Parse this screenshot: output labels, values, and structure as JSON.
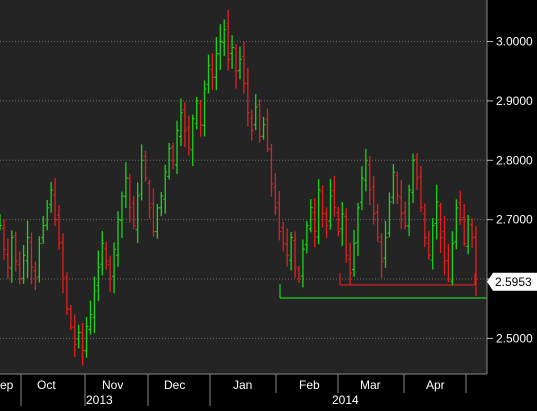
{
  "chart_data": {
    "type": "ohlc",
    "colors": {
      "up": "#1ed21e",
      "down": "#e02020",
      "support": "#22cc22",
      "resistance": "#e02020",
      "grid": "#6a6a6a",
      "text": "#ffffff",
      "price_tag_bg": "#ffffff",
      "price_tag_text": "#000000"
    },
    "y_axis": {
      "range": [
        2.44,
        3.07
      ],
      "ticks": [
        "3.0000",
        "2.9000",
        "2.8000",
        "2.7000",
        "2.6000",
        "2.5000"
      ],
      "tick_values": [
        3.0,
        2.9,
        2.8,
        2.7,
        2.6,
        2.5
      ]
    },
    "x_axis": {
      "months": [
        "Sep",
        "Oct",
        "Nov",
        "Dec",
        "Jan",
        "Feb",
        "Mar",
        "Apr"
      ],
      "years": [
        "2013",
        "2014"
      ]
    },
    "last_price": "2.5953",
    "last_price_value": 2.5953,
    "levels": [
      {
        "name": "support",
        "value": 2.568,
        "color": "#22cc22"
      },
      {
        "name": "resistance",
        "value": 2.59,
        "color": "#e02020"
      }
    ],
    "closes": [
      2.69,
      2.65,
      2.62,
      2.67,
      2.63,
      2.6,
      2.64,
      2.67,
      2.62,
      2.6,
      2.66,
      2.69,
      2.72,
      2.75,
      2.7,
      2.66,
      2.6,
      2.55,
      2.52,
      2.49,
      2.51,
      2.48,
      2.52,
      2.54,
      2.58,
      2.62,
      2.66,
      2.63,
      2.6,
      2.65,
      2.7,
      2.74,
      2.77,
      2.72,
      2.69,
      2.74,
      2.8,
      2.77,
      2.72,
      2.68,
      2.72,
      2.74,
      2.78,
      2.82,
      2.8,
      2.85,
      2.88,
      2.85,
      2.82,
      2.87,
      2.9,
      2.86,
      2.92,
      2.96,
      2.94,
      2.98,
      3.0,
      3.02,
      2.97,
      2.99,
      2.95,
      2.97,
      2.93,
      2.88,
      2.85,
      2.89,
      2.84,
      2.86,
      2.82,
      2.76,
      2.72,
      2.68,
      2.66,
      2.64,
      2.67,
      2.62,
      2.6,
      2.65,
      2.69,
      2.72,
      2.68,
      2.75,
      2.71,
      2.69,
      2.74,
      2.72,
      2.68,
      2.71,
      2.64,
      2.61,
      2.66,
      2.72,
      2.77,
      2.8,
      2.75,
      2.71,
      2.67,
      2.63,
      2.67,
      2.73,
      2.78,
      2.74,
      2.71,
      2.69,
      2.75,
      2.8,
      2.77,
      2.72,
      2.67,
      2.64,
      2.69,
      2.73,
      2.67,
      2.63,
      2.6,
      2.66,
      2.72,
      2.7,
      2.66,
      2.7,
      2.67,
      2.6
    ]
  },
  "labels": {
    "month_sep": "ep",
    "month_oct": "Oct",
    "month_nov": "Nov",
    "month_dec": "Dec",
    "month_jan": "Jan",
    "month_feb": "Feb",
    "month_mar": "Mar",
    "month_apr": "Apr",
    "year_2013": "2013",
    "year_2014": "2014"
  }
}
